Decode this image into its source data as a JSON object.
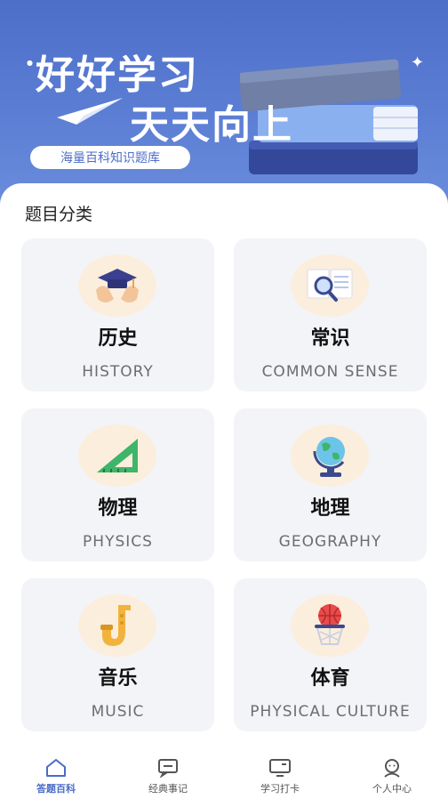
{
  "banner": {
    "title_line1": "好好学习",
    "title_line2": "天天向上",
    "badge": "海量百科知识题库"
  },
  "section": {
    "title": "题目分类"
  },
  "categories": [
    {
      "name": "历史",
      "en": "HISTORY",
      "icon": "graduation-cap-hands-icon"
    },
    {
      "name": "常识",
      "en": "COMMON SENSE",
      "icon": "book-magnifier-icon"
    },
    {
      "name": "物理",
      "en": "PHYSICS",
      "icon": "set-square-icon"
    },
    {
      "name": "地理",
      "en": "GEOGRAPHY",
      "icon": "globe-icon"
    },
    {
      "name": "音乐",
      "en": "MUSIC",
      "icon": "saxophone-icon"
    },
    {
      "name": "体育",
      "en": "PHYSICAL CULTURE",
      "icon": "basketball-hoop-icon"
    }
  ],
  "tabbar": {
    "items": [
      {
        "label": "答题百科",
        "icon": "home-icon",
        "active": true
      },
      {
        "label": "经典事记",
        "icon": "chat-card-icon",
        "active": false
      },
      {
        "label": "学习打卡",
        "icon": "monitor-icon",
        "active": false
      },
      {
        "label": "个人中心",
        "icon": "person-icon",
        "active": false
      }
    ]
  },
  "colors": {
    "banner": "#5b7ed4",
    "accent": "#4a6cc8",
    "card_bg": "#f3f4f8",
    "icon_bg": "#fbeedd"
  }
}
